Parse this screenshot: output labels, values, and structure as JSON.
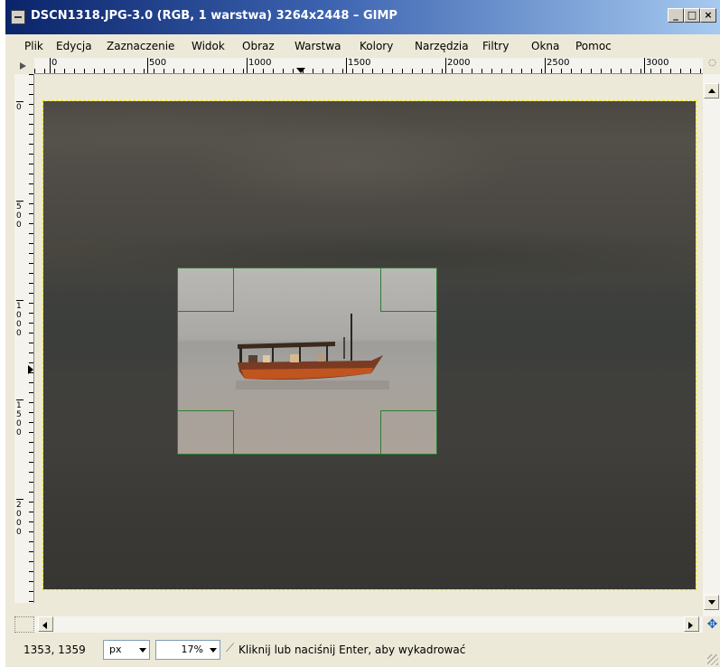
{
  "window": {
    "title": "DSCN1318.JPG-3.0 (RGB, 1 warstwa) 3264x2448 – GIMP",
    "minimize": "_",
    "maximize": "□",
    "close": "×"
  },
  "menu": [
    {
      "label": "Plik"
    },
    {
      "label": "Edycja"
    },
    {
      "label": "Zaznaczenie"
    },
    {
      "label": "Widok"
    },
    {
      "label": "Obraz"
    },
    {
      "label": "Warstwa"
    },
    {
      "label": "Kolory"
    },
    {
      "label": "Narzędzia"
    },
    {
      "label": "Filtry"
    },
    {
      "label": "Okna"
    },
    {
      "label": "Pomoc"
    }
  ],
  "ruler": {
    "h_labels": [
      "0",
      "500",
      "1000",
      "1500",
      "2000",
      "2500",
      "3000"
    ],
    "v_labels": [
      "0",
      "500",
      "1000",
      "1500",
      "2000"
    ]
  },
  "status": {
    "coords": "1353, 1359",
    "unit": "px",
    "zoom": "17%",
    "message": "Kliknij lub naciśnij Enter, aby wykadrować"
  },
  "icons": {
    "status_tool": "crop-tool-icon",
    "navigate": "navigate-icon",
    "quick_mask": "quick-mask-icon"
  },
  "colors": {
    "crop_frame": "#2e7d32",
    "image_boundary": "#e8e000",
    "titlebar": "#0a246a"
  }
}
